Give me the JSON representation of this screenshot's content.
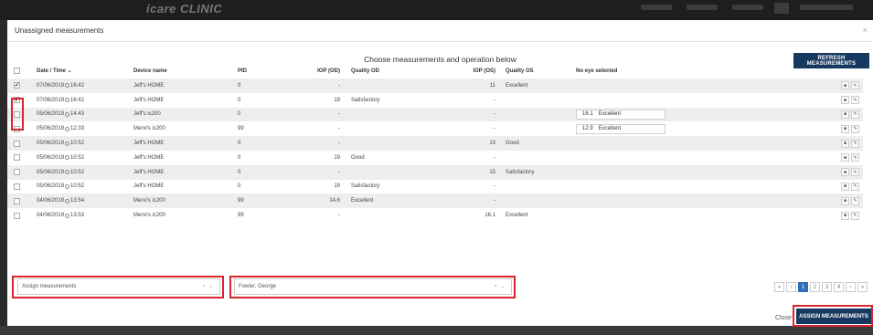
{
  "backdrop": {
    "brand": "icare CLINIC"
  },
  "modal": {
    "title": "Unassigned measurements",
    "close_icon": "×",
    "instruction": "Choose measurements and operation below",
    "refresh_label": "REFRESH MEASUREMENTS"
  },
  "table": {
    "headers": {
      "date": "Date / Time ⌄",
      "device": "Device name",
      "pid": "PID",
      "iop_od": "IOP (OD)",
      "quality_od": "Quality OD",
      "iop_os": "IOP (OS)",
      "quality_os": "Quality OS",
      "no_eye": "No eye selected"
    },
    "rows": [
      {
        "checked": true,
        "date": "07/06/2019",
        "time": "16:42",
        "device": "Jeff's HOME",
        "pid": "0",
        "iop_od": "-",
        "quality_od": "",
        "iop_os": "11",
        "quality_os": "Excellent",
        "no_eye_value": "",
        "no_eye_quality": ""
      },
      {
        "checked": true,
        "date": "07/06/2019",
        "time": "16:42",
        "device": "Jeff's HOME",
        "pid": "0",
        "iop_od": "19",
        "quality_od": "Satisfactory",
        "iop_os": "-",
        "quality_os": "",
        "no_eye_value": "",
        "no_eye_quality": ""
      },
      {
        "checked": false,
        "date": "05/06/2019",
        "time": "14:43",
        "device": "Jeff's ic200",
        "pid": "0",
        "iop_od": "-",
        "quality_od": "",
        "iop_os": "-",
        "quality_os": "",
        "no_eye_value": "16.1",
        "no_eye_quality": "Excellent"
      },
      {
        "checked": false,
        "date": "05/06/2019",
        "time": "12:33",
        "device": "Mervi's ic200",
        "pid": "99",
        "iop_od": "-",
        "quality_od": "",
        "iop_os": "-",
        "quality_os": "",
        "no_eye_value": "12.9",
        "no_eye_quality": "Excellent"
      },
      {
        "checked": false,
        "date": "05/06/2019",
        "time": "10:52",
        "device": "Jeff's HOME",
        "pid": "0",
        "iop_od": "-",
        "quality_od": "",
        "iop_os": "13",
        "quality_os": "Good",
        "no_eye_value": "",
        "no_eye_quality": ""
      },
      {
        "checked": false,
        "date": "05/06/2019",
        "time": "10:52",
        "device": "Jeff's HOME",
        "pid": "0",
        "iop_od": "19",
        "quality_od": "Good",
        "iop_os": "-",
        "quality_os": "",
        "no_eye_value": "",
        "no_eye_quality": ""
      },
      {
        "checked": false,
        "date": "05/06/2019",
        "time": "10:52",
        "device": "Jeff's HOME",
        "pid": "0",
        "iop_od": "-",
        "quality_od": "",
        "iop_os": "15",
        "quality_os": "Satisfactory",
        "no_eye_value": "",
        "no_eye_quality": ""
      },
      {
        "checked": false,
        "date": "05/06/2019",
        "time": "10:52",
        "device": "Jeff's HOME",
        "pid": "0",
        "iop_od": "19",
        "quality_od": "Satisfactory",
        "iop_os": "-",
        "quality_os": "",
        "no_eye_value": "",
        "no_eye_quality": ""
      },
      {
        "checked": false,
        "date": "04/06/2019",
        "time": "13:54",
        "device": "Mervi's ic200",
        "pid": "99",
        "iop_od": "14.6",
        "quality_od": "Excellent",
        "iop_os": "-",
        "quality_os": "",
        "no_eye_value": "",
        "no_eye_quality": ""
      },
      {
        "checked": false,
        "date": "04/06/2019",
        "time": "13:53",
        "device": "Mervi's ic200",
        "pid": "99",
        "iop_od": "-",
        "quality_od": "",
        "iop_os": "16.1",
        "quality_os": "Excellent",
        "no_eye_value": "",
        "no_eye_quality": ""
      }
    ]
  },
  "controls": {
    "assign_select": "Assign measurements",
    "patient_select": "Fowler, George",
    "select_arrows": "× ⌄",
    "pagination": [
      "«",
      "‹",
      "1",
      "2",
      "3",
      "4",
      "›",
      "»"
    ],
    "active_page": "1",
    "close_label": "Close",
    "assign_label": "ASSIGN MEASUREMENTS"
  },
  "icons": {
    "row_delete": "trash-icon",
    "row_edit": "pencil-icon"
  },
  "colors": {
    "primary_button": "#17395f",
    "highlight": "#d9232d",
    "active_page": "#2d6fb7"
  }
}
